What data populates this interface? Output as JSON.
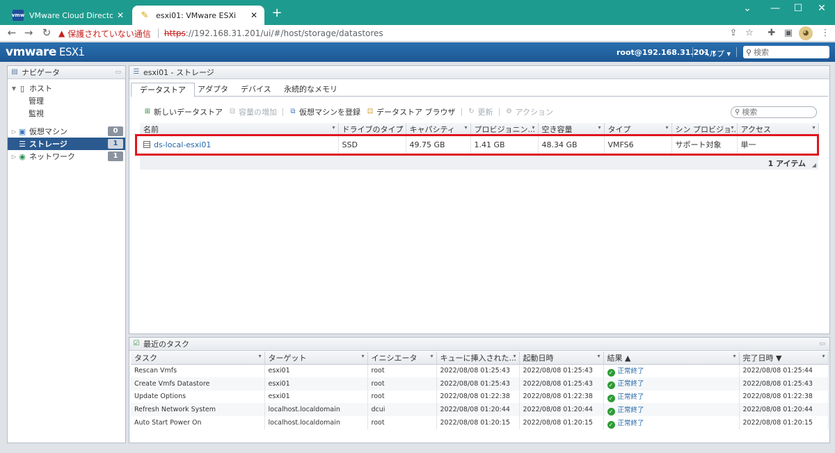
{
  "browser": {
    "tabs": [
      {
        "title": "VMware Cloud Director - 仮想マ",
        "favicon": "vmw"
      },
      {
        "title": "esxi01: VMware ESXi",
        "favicon": "✎"
      }
    ],
    "new_tab": "+",
    "window_controls": {
      "chevron": "⌄",
      "minimize": "—",
      "maximize": "☐",
      "close": "✕"
    },
    "nav": {
      "back": "←",
      "forward": "→",
      "reload": "↻"
    },
    "address": {
      "warning_icon": "▲",
      "warning": "保護されていない通信",
      "scheme": "https",
      "rest": "://192.168.31.201/ui/#/host/storage/datastores"
    }
  },
  "header": {
    "logo_vm": "vmware",
    "logo_esxi": "ESXi",
    "user": "root@192.168.31.201 ▾",
    "help": "ヘルプ ▾",
    "search_placeholder": "検索"
  },
  "navigator": {
    "title": "ナビゲータ",
    "host": "ホスト",
    "host_children": [
      "管理",
      "監視"
    ],
    "items": [
      {
        "label": "仮想マシン",
        "badge": "0"
      },
      {
        "label": "ストレージ",
        "badge": "1"
      },
      {
        "label": "ネットワーク",
        "badge": "1"
      }
    ]
  },
  "main": {
    "title": "esxi01 - ストレージ",
    "tabs": [
      "データストア",
      "アダプタ",
      "デバイス",
      "永続的なメモリ"
    ],
    "toolbar": {
      "new_datastore": "新しいデータストア",
      "increase_capacity": "容量の増加",
      "register_vm": "仮想マシンを登録",
      "datastore_browser": "データストア ブラウザ",
      "refresh": "更新",
      "actions": "アクション"
    },
    "search_placeholder": "検索",
    "columns": [
      "名前",
      "ドライブのタイプ",
      "キャパシティ",
      "プロビジョニン...",
      "空き容量",
      "タイプ",
      "シン プロビジョ...",
      "アクセス"
    ],
    "rows": [
      {
        "name": "ds-local-esxi01",
        "drive": "SSD",
        "capacity": "49.75 GB",
        "provisioned": "1.41 GB",
        "free": "48.34 GB",
        "type": "VMFS6",
        "thin": "サポート対象",
        "access": "単一"
      }
    ],
    "item_count": "1 アイテム"
  },
  "tasks": {
    "title": "最近のタスク",
    "columns": [
      "タスク",
      "ターゲット",
      "イニシエータ",
      "キューに挿入された...",
      "起動日時",
      "結果 ▲",
      "完了日時 ▼"
    ],
    "rows": [
      {
        "task": "Rescan Vmfs",
        "target": "esxi01",
        "initiator": "root",
        "queued": "2022/08/08 01:25:43",
        "started": "2022/08/08 01:25:43",
        "result": "正常終了",
        "completed": "2022/08/08 01:25:44"
      },
      {
        "task": "Create Vmfs Datastore",
        "target": "esxi01",
        "initiator": "root",
        "queued": "2022/08/08 01:25:43",
        "started": "2022/08/08 01:25:43",
        "result": "正常終了",
        "completed": "2022/08/08 01:25:43"
      },
      {
        "task": "Update Options",
        "target": "esxi01",
        "initiator": "root",
        "queued": "2022/08/08 01:22:38",
        "started": "2022/08/08 01:22:38",
        "result": "正常終了",
        "completed": "2022/08/08 01:22:38"
      },
      {
        "task": "Refresh Network System",
        "target": "localhost.localdomain",
        "initiator": "dcui",
        "queued": "2022/08/08 01:20:44",
        "started": "2022/08/08 01:20:44",
        "result": "正常終了",
        "completed": "2022/08/08 01:20:44"
      },
      {
        "task": "Auto Start Power On",
        "target": "localhost.localdomain",
        "initiator": "root",
        "queued": "2022/08/08 01:20:15",
        "started": "2022/08/08 01:20:15",
        "result": "正常終了",
        "completed": "2022/08/08 01:20:15"
      }
    ]
  },
  "colors": {
    "header_blue": "#1c5894",
    "selection": "#2b5a90",
    "highlight_red": "#e0141e",
    "success": "#2e9b36",
    "link": "#2166a8"
  }
}
